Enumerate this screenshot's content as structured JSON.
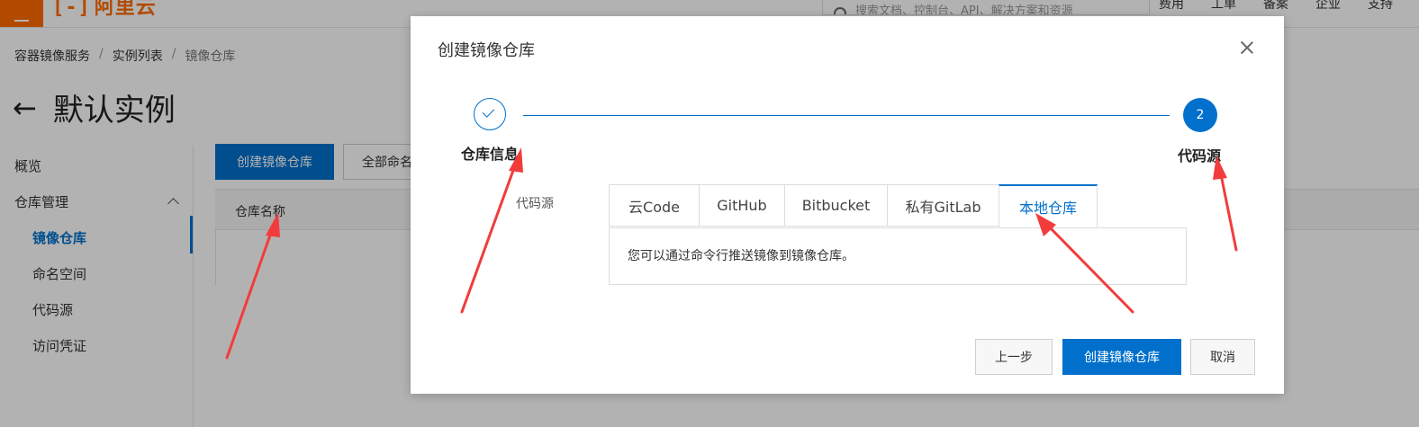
{
  "header": {
    "brand": "阿里云",
    "search_placeholder": "搜索文档、控制台、API、解决方案和资源",
    "links": [
      "费用",
      "工单",
      "备案",
      "企业",
      "支持"
    ]
  },
  "breadcrumb": [
    "容器镜像服务",
    "实例列表",
    "镜像仓库"
  ],
  "page": {
    "title": "默认实例"
  },
  "sidebar": {
    "items": [
      {
        "label": "概览"
      },
      {
        "label": "仓库管理"
      },
      {
        "label": "镜像仓库"
      },
      {
        "label": "命名空间"
      },
      {
        "label": "代码源"
      },
      {
        "label": "访问凭证"
      }
    ]
  },
  "toolbar": {
    "create_label": "创建镜像仓库",
    "namespace_label": "全部命名空间"
  },
  "table": {
    "columns": [
      "仓库名称"
    ]
  },
  "dialog": {
    "title": "创建镜像仓库",
    "steps": [
      {
        "number": "1",
        "label": "仓库信息",
        "status": "done"
      },
      {
        "number": "2",
        "label": "代码源",
        "status": "current"
      }
    ],
    "field_label": "代码源",
    "tabs": [
      "云Code",
      "GitHub",
      "Bitbucket",
      "私有GitLab",
      "本地仓库"
    ],
    "active_tab": "本地仓库",
    "panel_text": "您可以通过命令行推送镜像到镜像仓库。",
    "buttons": {
      "prev": "上一步",
      "create": "创建镜像仓库",
      "cancel": "取消"
    }
  },
  "colors": {
    "primary": "#0070cc",
    "brand": "#ff6a00",
    "annotation": "#f23c3c"
  }
}
